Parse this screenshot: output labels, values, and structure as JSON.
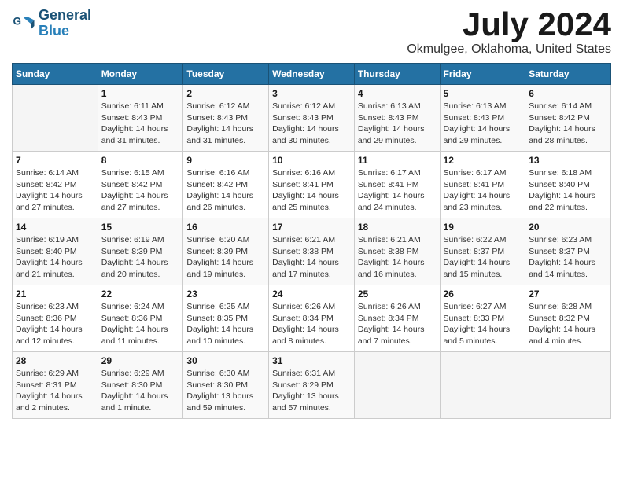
{
  "header": {
    "logo_line1": "General",
    "logo_line2": "Blue",
    "month_title": "July 2024",
    "location": "Okmulgee, Oklahoma, United States"
  },
  "calendar": {
    "days_of_week": [
      "Sunday",
      "Monday",
      "Tuesday",
      "Wednesday",
      "Thursday",
      "Friday",
      "Saturday"
    ],
    "weeks": [
      [
        {
          "day": "",
          "info": ""
        },
        {
          "day": "1",
          "info": "Sunrise: 6:11 AM\nSunset: 8:43 PM\nDaylight: 14 hours\nand 31 minutes."
        },
        {
          "day": "2",
          "info": "Sunrise: 6:12 AM\nSunset: 8:43 PM\nDaylight: 14 hours\nand 31 minutes."
        },
        {
          "day": "3",
          "info": "Sunrise: 6:12 AM\nSunset: 8:43 PM\nDaylight: 14 hours\nand 30 minutes."
        },
        {
          "day": "4",
          "info": "Sunrise: 6:13 AM\nSunset: 8:43 PM\nDaylight: 14 hours\nand 29 minutes."
        },
        {
          "day": "5",
          "info": "Sunrise: 6:13 AM\nSunset: 8:43 PM\nDaylight: 14 hours\nand 29 minutes."
        },
        {
          "day": "6",
          "info": "Sunrise: 6:14 AM\nSunset: 8:42 PM\nDaylight: 14 hours\nand 28 minutes."
        }
      ],
      [
        {
          "day": "7",
          "info": "Sunrise: 6:14 AM\nSunset: 8:42 PM\nDaylight: 14 hours\nand 27 minutes."
        },
        {
          "day": "8",
          "info": "Sunrise: 6:15 AM\nSunset: 8:42 PM\nDaylight: 14 hours\nand 27 minutes."
        },
        {
          "day": "9",
          "info": "Sunrise: 6:16 AM\nSunset: 8:42 PM\nDaylight: 14 hours\nand 26 minutes."
        },
        {
          "day": "10",
          "info": "Sunrise: 6:16 AM\nSunset: 8:41 PM\nDaylight: 14 hours\nand 25 minutes."
        },
        {
          "day": "11",
          "info": "Sunrise: 6:17 AM\nSunset: 8:41 PM\nDaylight: 14 hours\nand 24 minutes."
        },
        {
          "day": "12",
          "info": "Sunrise: 6:17 AM\nSunset: 8:41 PM\nDaylight: 14 hours\nand 23 minutes."
        },
        {
          "day": "13",
          "info": "Sunrise: 6:18 AM\nSunset: 8:40 PM\nDaylight: 14 hours\nand 22 minutes."
        }
      ],
      [
        {
          "day": "14",
          "info": "Sunrise: 6:19 AM\nSunset: 8:40 PM\nDaylight: 14 hours\nand 21 minutes."
        },
        {
          "day": "15",
          "info": "Sunrise: 6:19 AM\nSunset: 8:39 PM\nDaylight: 14 hours\nand 20 minutes."
        },
        {
          "day": "16",
          "info": "Sunrise: 6:20 AM\nSunset: 8:39 PM\nDaylight: 14 hours\nand 19 minutes."
        },
        {
          "day": "17",
          "info": "Sunrise: 6:21 AM\nSunset: 8:38 PM\nDaylight: 14 hours\nand 17 minutes."
        },
        {
          "day": "18",
          "info": "Sunrise: 6:21 AM\nSunset: 8:38 PM\nDaylight: 14 hours\nand 16 minutes."
        },
        {
          "day": "19",
          "info": "Sunrise: 6:22 AM\nSunset: 8:37 PM\nDaylight: 14 hours\nand 15 minutes."
        },
        {
          "day": "20",
          "info": "Sunrise: 6:23 AM\nSunset: 8:37 PM\nDaylight: 14 hours\nand 14 minutes."
        }
      ],
      [
        {
          "day": "21",
          "info": "Sunrise: 6:23 AM\nSunset: 8:36 PM\nDaylight: 14 hours\nand 12 minutes."
        },
        {
          "day": "22",
          "info": "Sunrise: 6:24 AM\nSunset: 8:36 PM\nDaylight: 14 hours\nand 11 minutes."
        },
        {
          "day": "23",
          "info": "Sunrise: 6:25 AM\nSunset: 8:35 PM\nDaylight: 14 hours\nand 10 minutes."
        },
        {
          "day": "24",
          "info": "Sunrise: 6:26 AM\nSunset: 8:34 PM\nDaylight: 14 hours\nand 8 minutes."
        },
        {
          "day": "25",
          "info": "Sunrise: 6:26 AM\nSunset: 8:34 PM\nDaylight: 14 hours\nand 7 minutes."
        },
        {
          "day": "26",
          "info": "Sunrise: 6:27 AM\nSunset: 8:33 PM\nDaylight: 14 hours\nand 5 minutes."
        },
        {
          "day": "27",
          "info": "Sunrise: 6:28 AM\nSunset: 8:32 PM\nDaylight: 14 hours\nand 4 minutes."
        }
      ],
      [
        {
          "day": "28",
          "info": "Sunrise: 6:29 AM\nSunset: 8:31 PM\nDaylight: 14 hours\nand 2 minutes."
        },
        {
          "day": "29",
          "info": "Sunrise: 6:29 AM\nSunset: 8:30 PM\nDaylight: 14 hours\nand 1 minute."
        },
        {
          "day": "30",
          "info": "Sunrise: 6:30 AM\nSunset: 8:30 PM\nDaylight: 13 hours\nand 59 minutes."
        },
        {
          "day": "31",
          "info": "Sunrise: 6:31 AM\nSunset: 8:29 PM\nDaylight: 13 hours\nand 57 minutes."
        },
        {
          "day": "",
          "info": ""
        },
        {
          "day": "",
          "info": ""
        },
        {
          "day": "",
          "info": ""
        }
      ]
    ]
  }
}
